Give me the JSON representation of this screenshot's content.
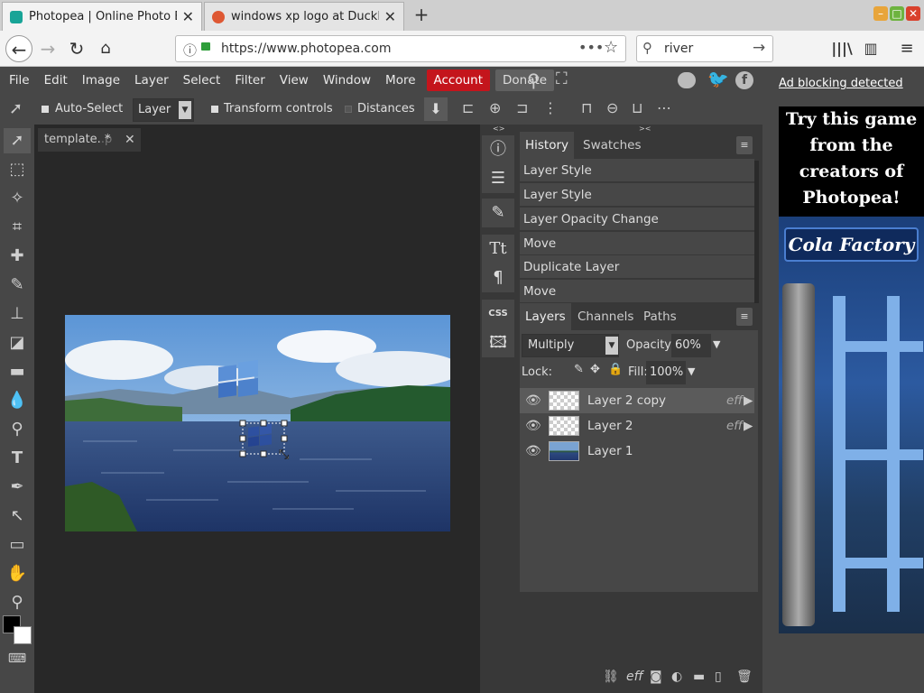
{
  "browser": {
    "tabs": [
      {
        "title": "Photopea | Online Photo Edit",
        "active": true
      },
      {
        "title": "windows xp logo at DuckDuc",
        "active": false
      }
    ],
    "url": "https://www.photopea.com",
    "search_value": "river",
    "new_tab": "+"
  },
  "menu": {
    "items": [
      "File",
      "Edit",
      "Image",
      "Layer",
      "Select",
      "Filter",
      "View",
      "Window",
      "More"
    ],
    "account": "Account",
    "donate": "Donate"
  },
  "options": {
    "auto_select": "Auto-Select",
    "target": "Layer",
    "transform_controls": "Transform controls",
    "distances": "Distances"
  },
  "document": {
    "tab_title": "template.",
    "modified_marker": "*"
  },
  "history": {
    "tab_label": "History",
    "swatches_label": "Swatches",
    "items": [
      "Layer Style",
      "Layer Style",
      "Layer Opacity Change",
      "Move",
      "Duplicate Layer",
      "Move"
    ]
  },
  "layers": {
    "tabs": [
      "Layers",
      "Channels",
      "Paths"
    ],
    "blend_mode": "Multiply",
    "opacity_label": "Opacity:",
    "opacity": "60%",
    "lock_label": "Lock:",
    "fill_label": "Fill:",
    "fill": "100%",
    "items": [
      {
        "name": "Layer 2 copy",
        "fx": "eff",
        "selected": true
      },
      {
        "name": "Layer 2",
        "fx": "eff",
        "selected": false
      },
      {
        "name": "Layer 1",
        "fx": "",
        "selected": false
      }
    ],
    "footer_fx": "eff"
  },
  "side_strip": {
    "css_label": "CSS"
  },
  "ad": {
    "notice": "Ad blocking detected",
    "headline": "Try this game from the creators of Photopea!",
    "game_title": "Cola Factory"
  }
}
